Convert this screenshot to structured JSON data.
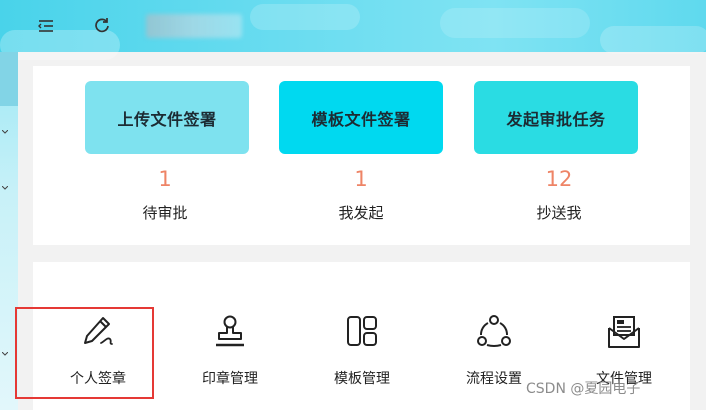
{
  "header": {
    "menu_icon": "menu-fold-icon",
    "refresh_icon": "refresh-icon",
    "title": ""
  },
  "quick_actions": [
    {
      "label": "上传文件签署",
      "bg": "#7ee2ef"
    },
    {
      "label": "模板文件签署",
      "bg": "#00d9f0"
    },
    {
      "label": "发起审批任务",
      "bg": "#2adce3"
    }
  ],
  "stats": [
    {
      "count": "1",
      "label": "待审批"
    },
    {
      "count": "1",
      "label": "我发起"
    },
    {
      "count": "12",
      "label": "抄送我"
    }
  ],
  "tools": [
    {
      "label": "个人签章",
      "icon": "pen-icon"
    },
    {
      "label": "印章管理",
      "icon": "stamp-icon"
    },
    {
      "label": "模板管理",
      "icon": "template-icon"
    },
    {
      "label": "流程设置",
      "icon": "workflow-icon"
    },
    {
      "label": "文件管理",
      "icon": "mail-file-icon"
    }
  ],
  "watermark": "CSDN @夏园电子",
  "colors": {
    "count": "#ee8466",
    "highlight": "#e53935"
  }
}
